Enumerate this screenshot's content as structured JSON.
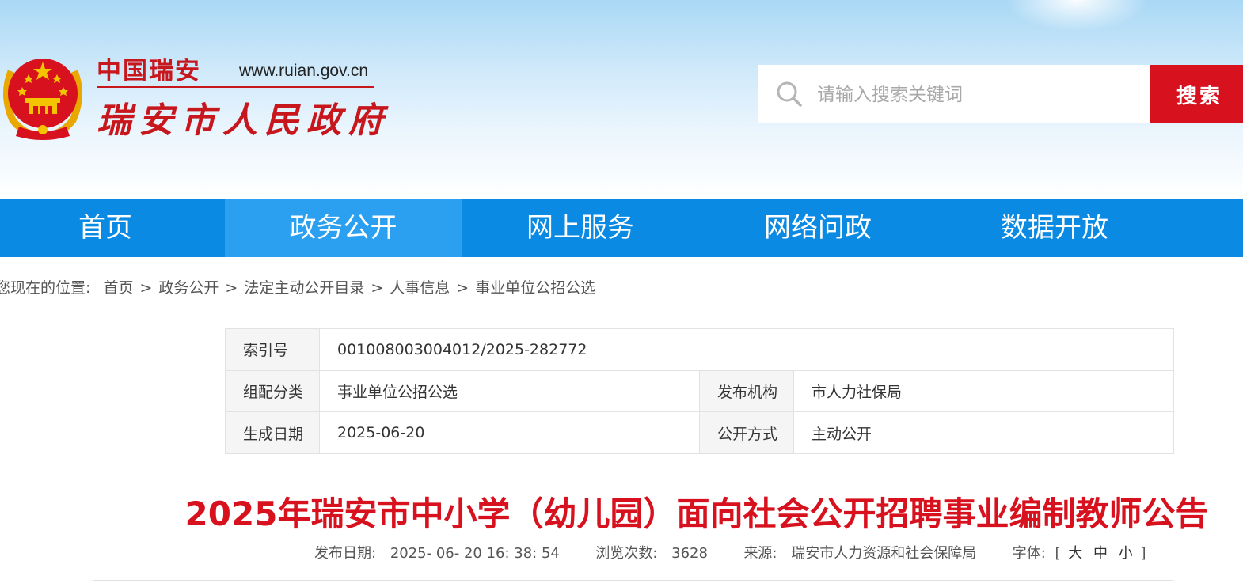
{
  "header": {
    "logo_small": "中国瑞安",
    "logo_url": "www.ruian.gov.cn",
    "logo_big": "瑞安市人民政府"
  },
  "search": {
    "placeholder": "请输入搜索关键词",
    "button_label": "搜索"
  },
  "nav": {
    "items": [
      {
        "label": "首页"
      },
      {
        "label": "政务公开"
      },
      {
        "label": "网上服务"
      },
      {
        "label": "网络问政"
      },
      {
        "label": "数据开放"
      }
    ],
    "active_index": 1
  },
  "breadcrumb": {
    "prefix": "您现在的位置:",
    "items": [
      "首页",
      "政务公开",
      "法定主动公开目录",
      "人事信息",
      "事业单位公招公选"
    ],
    "separator": ">"
  },
  "info": {
    "index_label": "索引号",
    "index_value": "001008003004012/2025-282772",
    "category_label": "组配分类",
    "category_value": "事业单位公招公选",
    "org_label": "发布机构",
    "org_value": "市人力社保局",
    "date_label": "生成日期",
    "date_value": "2025-06-20",
    "mode_label": "公开方式",
    "mode_value": "主动公开"
  },
  "article": {
    "title": "2025年瑞安市中小学（幼儿园）面向社会公开招聘事业编制教师公告",
    "publish_label": "发布日期:",
    "publish_value": "2025- 06- 20 16: 38: 54",
    "views_label": "浏览次数:",
    "views_value": "3628",
    "source_label": "来源:",
    "source_value": "瑞安市人力资源和社会保障局",
    "font_label": "字体:",
    "font_open": "[",
    "font_large": "大",
    "font_medium": "中",
    "font_small": "小",
    "font_close": "]"
  },
  "colors": {
    "brand_red": "#d7111e",
    "nav_blue": "#0b8ae3",
    "nav_active": "#2ba0f0"
  },
  "icons": {
    "emblem": "national-emblem-icon",
    "search": "search-icon"
  }
}
